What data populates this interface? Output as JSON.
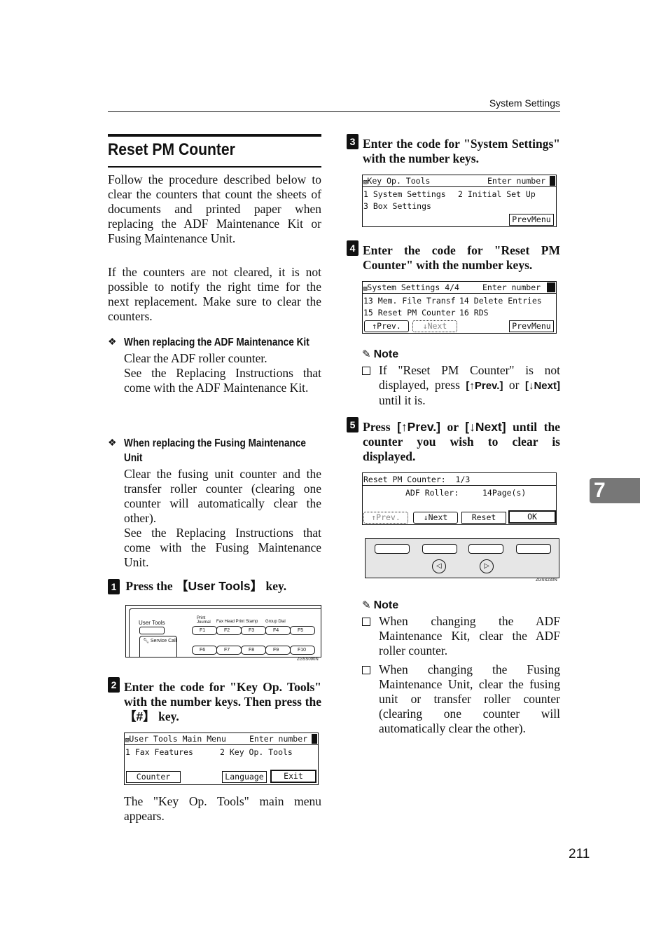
{
  "header": {
    "section": "System Settings"
  },
  "chapter_tab": "7",
  "page_number": "211",
  "title": "Reset PM Counter",
  "intro": [
    "Follow the procedure described below to clear the counters that count the sheets of documents and printed paper when replacing the ADF Maintenance Kit or Fusing Maintenance Unit.",
    "If the counters are not cleared, it is not possible to notify the right time for the next replacement. Make sure to clear the counters."
  ],
  "bullets": [
    {
      "heading": "When replacing the ADF Maintenance Kit",
      "text": [
        "Clear the ADF roller counter.",
        "See the Replacing Instructions that come with the ADF Maintenance Kit."
      ]
    },
    {
      "heading": "When replacing the Fusing Maintenance Unit",
      "text": [
        "Clear the fusing unit counter and the transfer roller counter (clearing one counter will automatically clear the other).",
        "See the Replacing Instructions that come with the Fusing Maintenance Unit."
      ]
    }
  ],
  "steps": [
    {
      "num": "1",
      "pre": "Press the ",
      "key": "【User Tools】",
      "post": " key."
    },
    {
      "num": "2",
      "text": "Enter the code for \"Key Op. Tools\" with the number keys. Then press the ",
      "key": "【#】",
      "post": " key."
    },
    {
      "num": "3",
      "text": "Enter the code for \"System Settings\" with the number keys."
    },
    {
      "num": "4",
      "text": "Enter the code for \"Reset PM Counter\" with the number keys."
    },
    {
      "num": "5",
      "pre": "Press ",
      "k1": "[↑Prev.]",
      "mid": " or ",
      "k2": "[↓Next]",
      "post": " until the counter you wish to clear is displayed."
    }
  ],
  "panel1": {
    "user_tools": "User Tools",
    "service_call": "Service Call",
    "labels": [
      "Print Journal",
      "Fax Head Print",
      "Stamp",
      "Group Dial"
    ],
    "keys_row1": [
      "F1",
      "F2",
      "F3",
      "F4",
      "F5"
    ],
    "keys_row2": [
      "F6",
      "F7",
      "F8",
      "F9",
      "F10"
    ],
    "code": "ZGSS090N"
  },
  "lcd_key_op": {
    "title": "User Tools Main Menu",
    "prompt": "Enter number",
    "items": [
      "1 Fax Features",
      "2 Key Op. Tools"
    ],
    "buttons": [
      "Counter",
      "Language",
      "Exit"
    ]
  },
  "step2_after": "The \"Key Op. Tools\" main menu appears.",
  "lcd_system": {
    "title": "Key Op. Tools",
    "prompt": "Enter number",
    "items": [
      "1 System Settings",
      "2 Initial Set Up",
      "3 Box Settings"
    ],
    "buttons": [
      "PrevMenu"
    ]
  },
  "lcd_reset": {
    "title": "System Settings 4/4",
    "prompt": "Enter number",
    "items": [
      "13 Mem. File Transf",
      "14 Delete Entries",
      "15 Reset PM Counter",
      "16 RDS"
    ],
    "buttons": [
      "↑Prev.",
      "↓Next",
      "PrevMenu"
    ]
  },
  "lcd_counter": {
    "title": "Reset PM Counter:  1/3",
    "line": "ADF Roller:",
    "value": "14Page(s)",
    "buttons": [
      "↑Prev.",
      "↓Next",
      "Reset",
      "OK"
    ],
    "code": "ZGSS230N"
  },
  "note1": {
    "heading": "Note",
    "items": [
      {
        "pre": "If \"Reset PM Counter\" is not displayed, press ",
        "k1": "[↑Prev.]",
        "mid": " or ",
        "k2": "[↓Next]",
        "post": " until it is."
      }
    ]
  },
  "note2": {
    "heading": "Note",
    "items": [
      "When changing the ADF Maintenance Kit, clear the ADF roller counter.",
      "When changing the Fusing Maintenance Unit, clear the fusing unit or transfer roller counter (clearing one counter will automatically clear the other)."
    ]
  }
}
